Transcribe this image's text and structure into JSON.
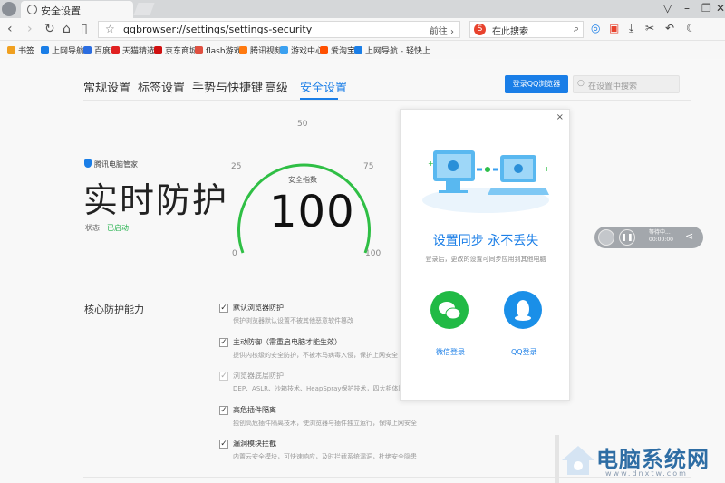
{
  "browser": {
    "tab_title": "安全设置",
    "tab_close": "×",
    "url": "qqbrowser://settings/settings-security",
    "go_label": "前往",
    "search_placeholder": "在此搜索",
    "win_min": "–",
    "win_max": "❐",
    "win_close": "✕"
  },
  "nav_icons": {
    "back": "‹",
    "forward": "›",
    "refresh": "↻",
    "home": "⌂",
    "reader": "▯"
  },
  "bookmarks": [
    {
      "label": "书签",
      "color": "#f0a020"
    },
    {
      "label": "上网导航",
      "color": "#1a7ee7"
    },
    {
      "label": "百度",
      "color": "#2b6de0"
    },
    {
      "label": "天猫精选",
      "color": "#e02020"
    },
    {
      "label": "京东商城",
      "color": "#d01010"
    },
    {
      "label": "flash游戏",
      "color": "#e05040"
    },
    {
      "label": "腾讯视频",
      "color": "#ff7a10"
    },
    {
      "label": "游戏中心",
      "color": "#3aa0f0"
    },
    {
      "label": "爱淘宝",
      "color": "#ff5000"
    },
    {
      "label": "上网导航 - 轻快上",
      "color": "#1a7ee7"
    }
  ],
  "settings_tabs": [
    "常规设置",
    "标签设置",
    "手势与快捷键",
    "高级",
    "安全设置"
  ],
  "login_button": "登录QQ浏览器",
  "settings_search_placeholder": "在设置中搜索",
  "guard": {
    "brand": "腾讯电脑管家",
    "title": "实时防护",
    "status_label": "状态",
    "status_value": "已启动"
  },
  "gauge": {
    "label": "安全指数",
    "value": "100",
    "ticks": [
      "0",
      "25",
      "50",
      "75",
      "100"
    ],
    "level": 1.0
  },
  "core": {
    "title": "核心防护能力",
    "options": [
      {
        "title": "默认浏览器防护",
        "desc": "保护浏览器默认设置不被其他恶意软件篡改",
        "checked": "✓"
      },
      {
        "title": "主动防御（需重启电脑才能生效）",
        "desc": "提供内核级的安全防护，不被木马病毒入侵，保护上网安全",
        "checked": "✓"
      },
      {
        "title": "浏览器底层防护",
        "desc": "DEP、ASLR、沙箱技术、HeapSpray保护技术，四大相体防护...",
        "checked": "✓"
      },
      {
        "title": "高危插件隔离",
        "desc": "独创高危插件隔离技术，使浏览器与插件独立运行，保障上网安全",
        "checked": "✓"
      },
      {
        "title": "漏洞模块拦截",
        "desc": "内置云安全模块，可快速响应，及时拦截系统漏洞，杜绝安全隐患",
        "checked": "✓"
      }
    ]
  },
  "popup": {
    "close": "×",
    "title": "设置同步 永不丢失",
    "subtitle": "登录后，更改的设置可同步应用到其他电脑",
    "wechat_label": "微信登录",
    "qq_label": "QQ登录"
  },
  "media": {
    "status": "等待中...",
    "time": "00:00:00"
  },
  "watermark": {
    "text": "电脑系统网",
    "url": "www.dnxtw.com"
  },
  "colors": {
    "accent": "#1a7ee7",
    "green": "#22b14c"
  }
}
